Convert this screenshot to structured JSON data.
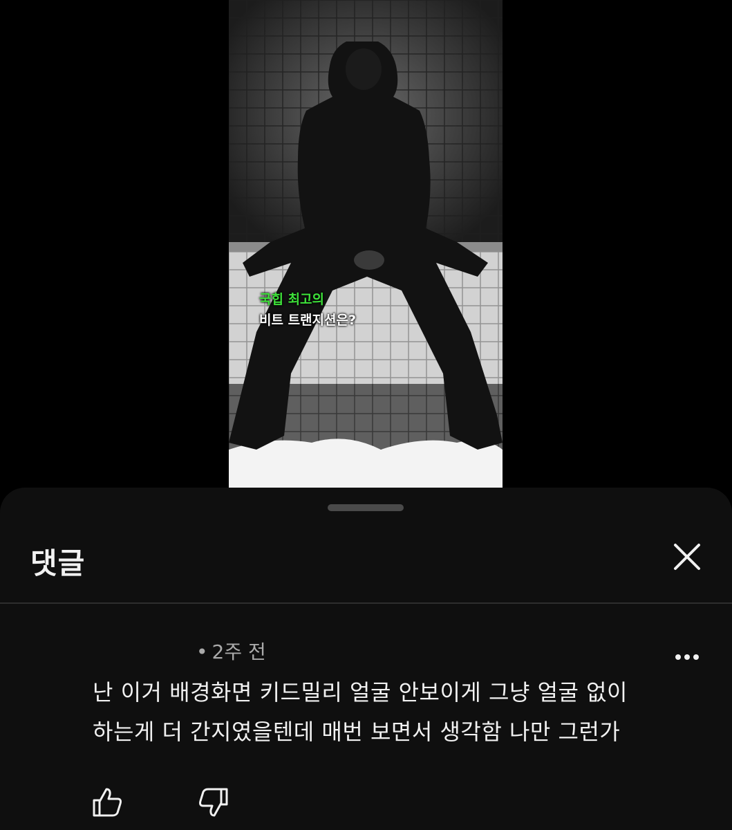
{
  "video": {
    "caption_line1": "국힙 최고의",
    "caption_line2": "비트 트랜지션은?",
    "caption_colors": {
      "highlight": "#3ee23a",
      "normal": "#ffffff"
    }
  },
  "comments_sheet": {
    "title": "댓글",
    "close_icon": "close-icon",
    "comment": {
      "meta": "2주 전",
      "meta_dot": "•",
      "text_line1": "난 이거 배경화면 키드밀리 얼굴 안보이게 그냥 얼굴 없이",
      "text_line2": "하는게 더 간지였을텐데 매번 보면서 생각함 나만 그런가",
      "more_icon": "more-vert-icon",
      "like_icon": "thumbs-up-icon",
      "dislike_icon": "thumbs-down-icon"
    }
  }
}
